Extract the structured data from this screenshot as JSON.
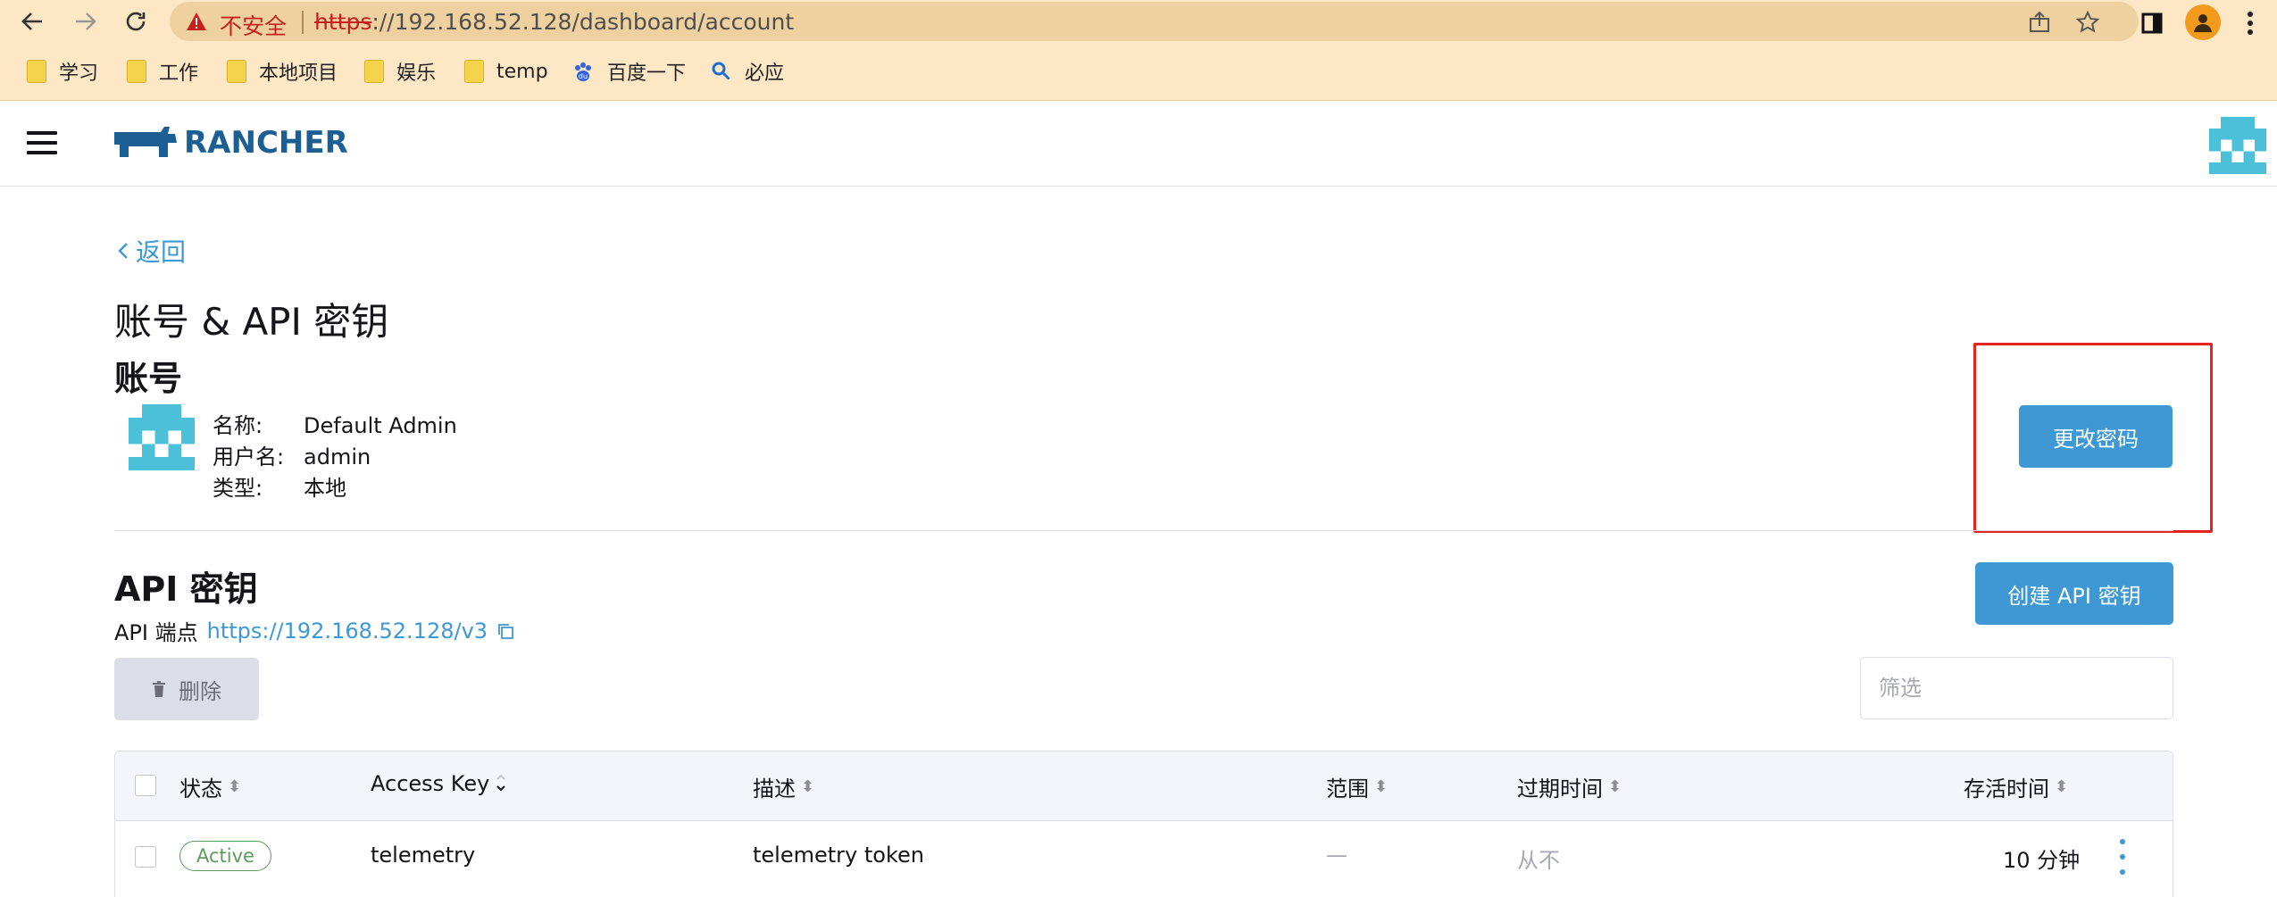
{
  "browser": {
    "insecure_label": "不安全",
    "url_scheme": "https",
    "url_rest": "://192.168.52.128/dashboard/account",
    "bookmarks": [
      {
        "label": "学习",
        "icon": "folder-icon"
      },
      {
        "label": "工作",
        "icon": "folder-icon"
      },
      {
        "label": "本地项目",
        "icon": "folder-icon"
      },
      {
        "label": "娱乐",
        "icon": "folder-icon"
      },
      {
        "label": "temp",
        "icon": "folder-icon"
      },
      {
        "label": "百度一下",
        "icon": "baidu-paw-icon"
      },
      {
        "label": "必应",
        "icon": "bing-search-icon"
      }
    ]
  },
  "header": {
    "logo_text": "RANCHER"
  },
  "page": {
    "back_label": "返回",
    "title": "账号 & API 密钥",
    "account_section_title": "账号",
    "account": {
      "name_label": "名称:",
      "name_value": "Default Admin",
      "username_label": "用户名:",
      "username_value": "admin",
      "type_label": "类型:",
      "type_value": "本地"
    },
    "change_password_label": "更改密码",
    "api_section_title": "API 密钥",
    "endpoint_label": "API 端点",
    "endpoint_url": "https://192.168.52.128/v3",
    "create_api_key_label": "创建 API 密钥",
    "delete_label": "删除",
    "filter_placeholder": "筛选"
  },
  "table": {
    "headers": {
      "state": "状态",
      "access_key": "Access Key",
      "description": "描述",
      "scope": "范围",
      "expires": "过期时间",
      "age": "存活时间"
    },
    "rows": [
      {
        "state": "Active",
        "access_key": "telemetry",
        "description": "telemetry token",
        "scope": "—",
        "expires": "从不",
        "age": "10 分钟"
      }
    ]
  },
  "colors": {
    "accent": "#3d98d3",
    "active_badge": "#5d995d",
    "highlight": "#e52420",
    "browser_bar": "#fde7c4"
  }
}
